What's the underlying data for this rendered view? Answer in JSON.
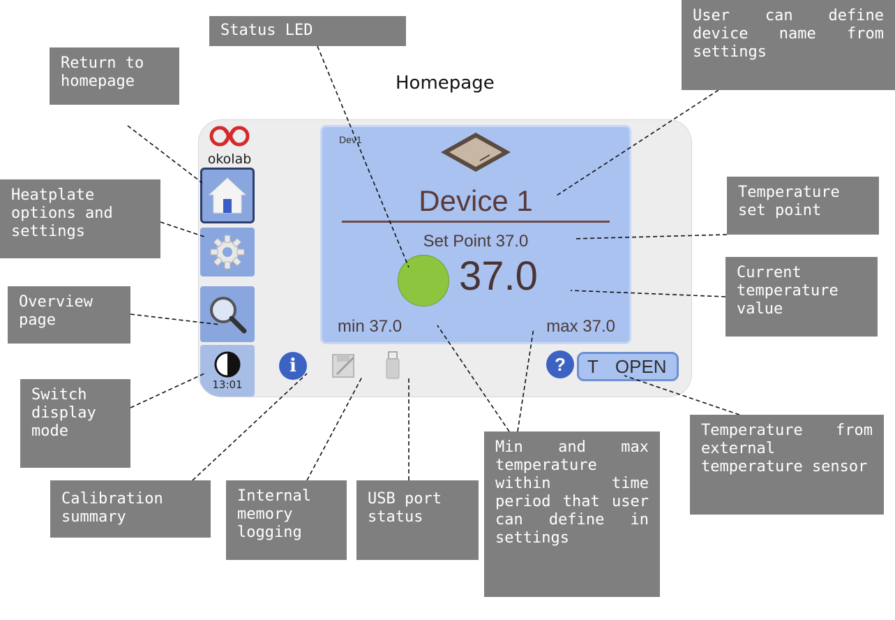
{
  "heading": "Homepage",
  "device": {
    "logo_text": "okolab",
    "clock": "13:01",
    "device_short_name": "Dev1",
    "device_name": "Device 1",
    "set_point_text": "Set Point 37.0",
    "current_temperature": "37.0",
    "min_text": "min 37.0",
    "max_text": "max 37.0",
    "info_glyph": "i",
    "help_glyph": "?",
    "external_sensor_prefix": "T",
    "external_sensor_value": "OPEN",
    "status_led_color": "#8cc63f",
    "icons": [
      "logo-icon",
      "home-icon",
      "gear-icon",
      "magnifier-icon",
      "contrast-icon",
      "info-icon",
      "memory-logging-icon",
      "usb-icon",
      "help-icon",
      "heatplate-icon"
    ]
  },
  "callouts": {
    "return_home": "Return to\nhomepage",
    "status_led": "Status LED",
    "device_name": "User can define device name from settings",
    "heatplate_options": "Heatplate\noptions and\nsettings",
    "temperature_set_point": "Temperature\nset point",
    "overview_page": "Overview\npage",
    "current_temperature": "Current\ntemperature\nvalue",
    "switch_display": "Switch\ndisplay\nmode",
    "calibration_summary": "Calibration\nsummary",
    "internal_memory": "Internal\nmemory\nlogging",
    "usb_port": "USB port\nstatus",
    "min_max": "Min and max temperature within time period that user can define in settings",
    "external_sensor": "Temperature from external temperature sensor"
  }
}
